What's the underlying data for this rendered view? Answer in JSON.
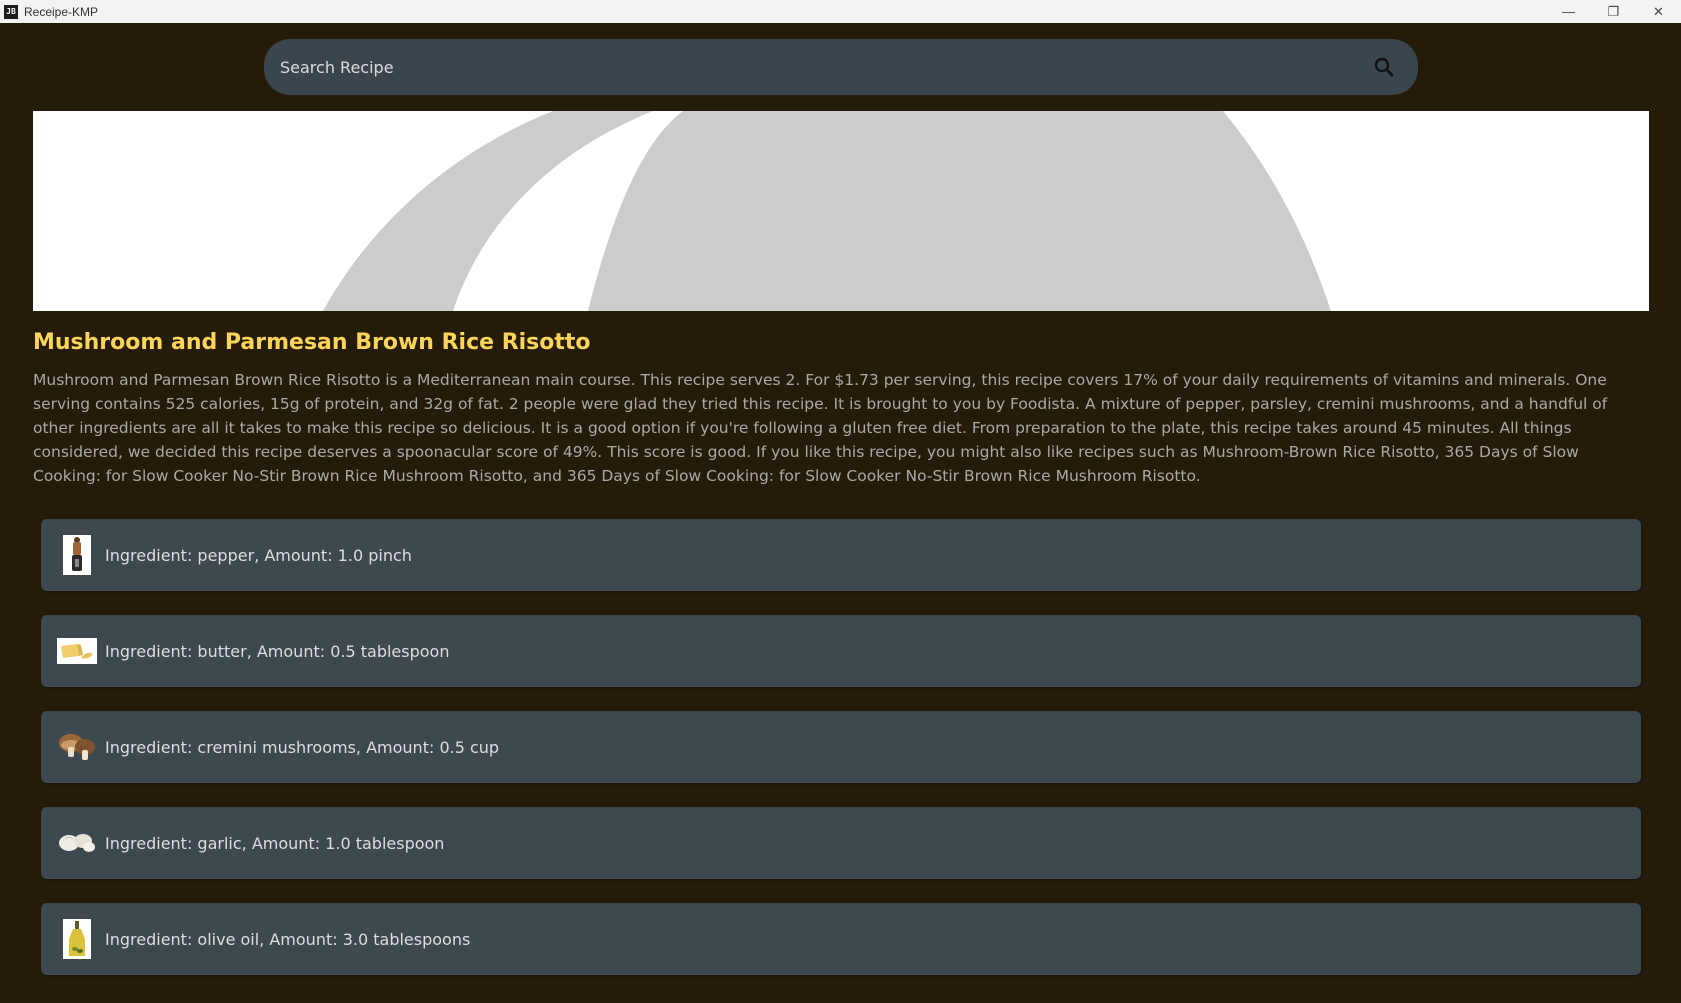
{
  "window": {
    "app_icon_text": "JB",
    "title": "Receipe-KMP",
    "minimize": "—",
    "restore": "❐",
    "close": "✕"
  },
  "search": {
    "placeholder": "Search Recipe",
    "icon": "search-icon"
  },
  "recipe": {
    "title": "Mushroom and Parmesan Brown Rice Risotto",
    "description": "Mushroom and Parmesan Brown Rice Risotto is a Mediterranean main course. This recipe serves 2. For $1.73 per serving, this recipe covers 17% of your daily requirements of vitamins and minerals. One serving contains 525 calories, 15g of protein, and 32g of fat. 2 people were glad they tried this recipe. It is brought to you by Foodista. A mixture of pepper, parsley, cremini mushrooms, and a handful of other ingredients are all it takes to make this recipe so delicious. It is a good option if you're following a gluten free diet. From preparation to the plate, this recipe takes around 45 minutes. All things considered, we decided this recipe deserves a spoonacular score of 49%. This score is good. If you like this recipe, you might also like recipes such as Mushroom-Brown Rice Risotto, 365 Days of Slow Cooking: for Slow Cooker No-Stir Brown Rice Mushroom Risotto, and 365 Days of Slow Cooking: for Slow Cooker No-Stir Brown Rice Mushroom Risotto."
  },
  "ingredients": [
    {
      "text": "Ingredient: pepper, Amount: 1.0 pinch",
      "icon": "pepper-grinder-icon"
    },
    {
      "text": "Ingredient: butter, Amount: 0.5 tablespoon",
      "icon": "butter-icon"
    },
    {
      "text": "Ingredient: cremini mushrooms, Amount: 0.5 cup",
      "icon": "mushroom-icon"
    },
    {
      "text": "Ingredient: garlic, Amount: 1.0 tablespoon",
      "icon": "garlic-icon"
    },
    {
      "text": "Ingredient: olive oil, Amount: 3.0 tablespoons",
      "icon": "olive-oil-icon"
    }
  ],
  "colors": {
    "background": "#241c08",
    "title": "#ffd45a",
    "card": "#3e484f",
    "search": "#3b454d"
  }
}
